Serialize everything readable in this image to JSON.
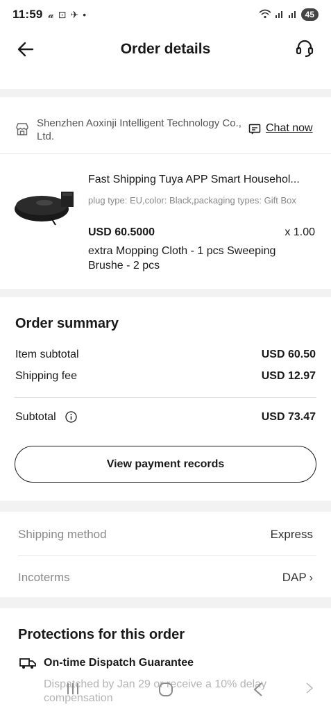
{
  "status_bar": {
    "time": "11:59",
    "battery": "45"
  },
  "header": {
    "title": "Order details"
  },
  "store": {
    "name": "Shenzhen Aoxinji Intelligent Technology Co., Ltd.",
    "chat_label": "Chat now"
  },
  "product": {
    "title": "Fast Shipping Tuya APP Smart Househol...",
    "attributes": "plug type: EU,color: Black,packaging types: Gift Box",
    "price": "USD 60.5000",
    "quantity": "x 1.00",
    "extras": "extra Mopping Cloth - 1 pcs Sweeping Brushe - 2 pcs"
  },
  "summary": {
    "title": "Order summary",
    "item_subtotal_label": "Item subtotal",
    "item_subtotal_value": "USD 60.50",
    "shipping_fee_label": "Shipping fee",
    "shipping_fee_value": "USD 12.97",
    "subtotal_label": "Subtotal",
    "subtotal_value": "USD 73.47",
    "payment_button": "View payment records"
  },
  "shipping": {
    "method_label": "Shipping method",
    "method_value": "Express",
    "incoterms_label": "Incoterms",
    "incoterms_value": "DAP"
  },
  "protections": {
    "title": "Protections for this order",
    "guarantee_title": "On-time Dispatch Guarantee",
    "guarantee_desc": "Dispatched by Jan 29 or receive a 10% delay compensation"
  }
}
